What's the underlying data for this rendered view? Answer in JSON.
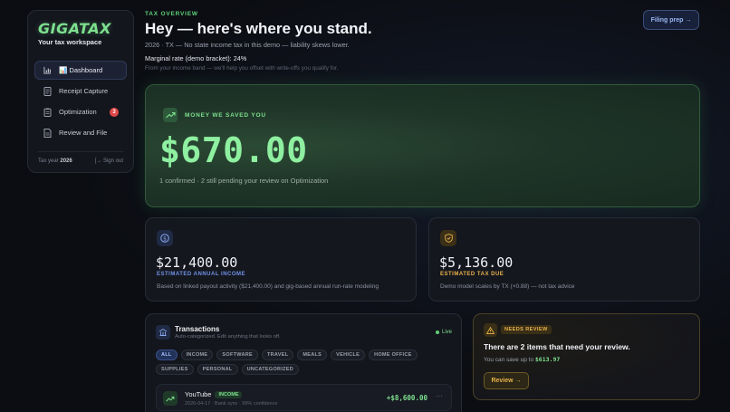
{
  "sidebar": {
    "brand": "GIGATAX",
    "tagline": "Your tax workspace",
    "items": [
      {
        "label": "📊 Dashboard",
        "active": true
      },
      {
        "label": "Receipt Capture"
      },
      {
        "label": "Optimization",
        "badge": "3"
      },
      {
        "label": "Review and File"
      }
    ],
    "tax_year_label": "Tax year",
    "tax_year": "2026",
    "sign_out": "Sign out"
  },
  "header": {
    "eyebrow": "TAX OVERVIEW",
    "title": "Hey — here's where you stand.",
    "subtitle": "2026 · TX — No state income tax in this demo — liability skews lower.",
    "marginal": "Marginal rate (demo bracket): 24%",
    "hint": "From your income band — we'll help you offset with write-offs you qualify for.",
    "filing_button": "Filing prep →"
  },
  "savings": {
    "label": "MONEY WE SAVED YOU",
    "amount": "$670.00",
    "note": "1 confirmed · 2 still pending your review on Optimization"
  },
  "income_card": {
    "amount": "$21,400.00",
    "label": "ESTIMATED ANNUAL INCOME",
    "note": "Based on linked payout activity ($21,400.00) and gig-based annual run-rate modeling"
  },
  "tax_card": {
    "amount": "$5,136.00",
    "label": "ESTIMATED TAX DUE",
    "note": "Demo model scales by TX (×0.88) — not tax advice"
  },
  "transactions": {
    "title": "Transactions",
    "subtitle": "Auto-categorized. Edit anything that looks off.",
    "live": "Live",
    "filters": [
      "ALL",
      "INCOME",
      "SOFTWARE",
      "TRAVEL",
      "MEALS",
      "VEHICLE",
      "HOME OFFICE",
      "SUPPLIES",
      "PERSONAL",
      "UNCATEGORIZED"
    ],
    "rows": [
      {
        "name": "YouTube",
        "tag": "INCOME",
        "meta": "2026-04-17 · Bank sync · 99% confidence",
        "amount": "+$8,600.00"
      }
    ]
  },
  "review": {
    "tag": "NEEDS REVIEW",
    "title": "There are 2 items that need your review.",
    "save_prefix": "You can save up to",
    "save_amount": "$613.97",
    "button": "Review →"
  },
  "colors": {
    "accent_green": "#7ee08f",
    "accent_blue": "#9ab4f0",
    "accent_amber": "#e8b24a",
    "danger": "#e04848"
  }
}
